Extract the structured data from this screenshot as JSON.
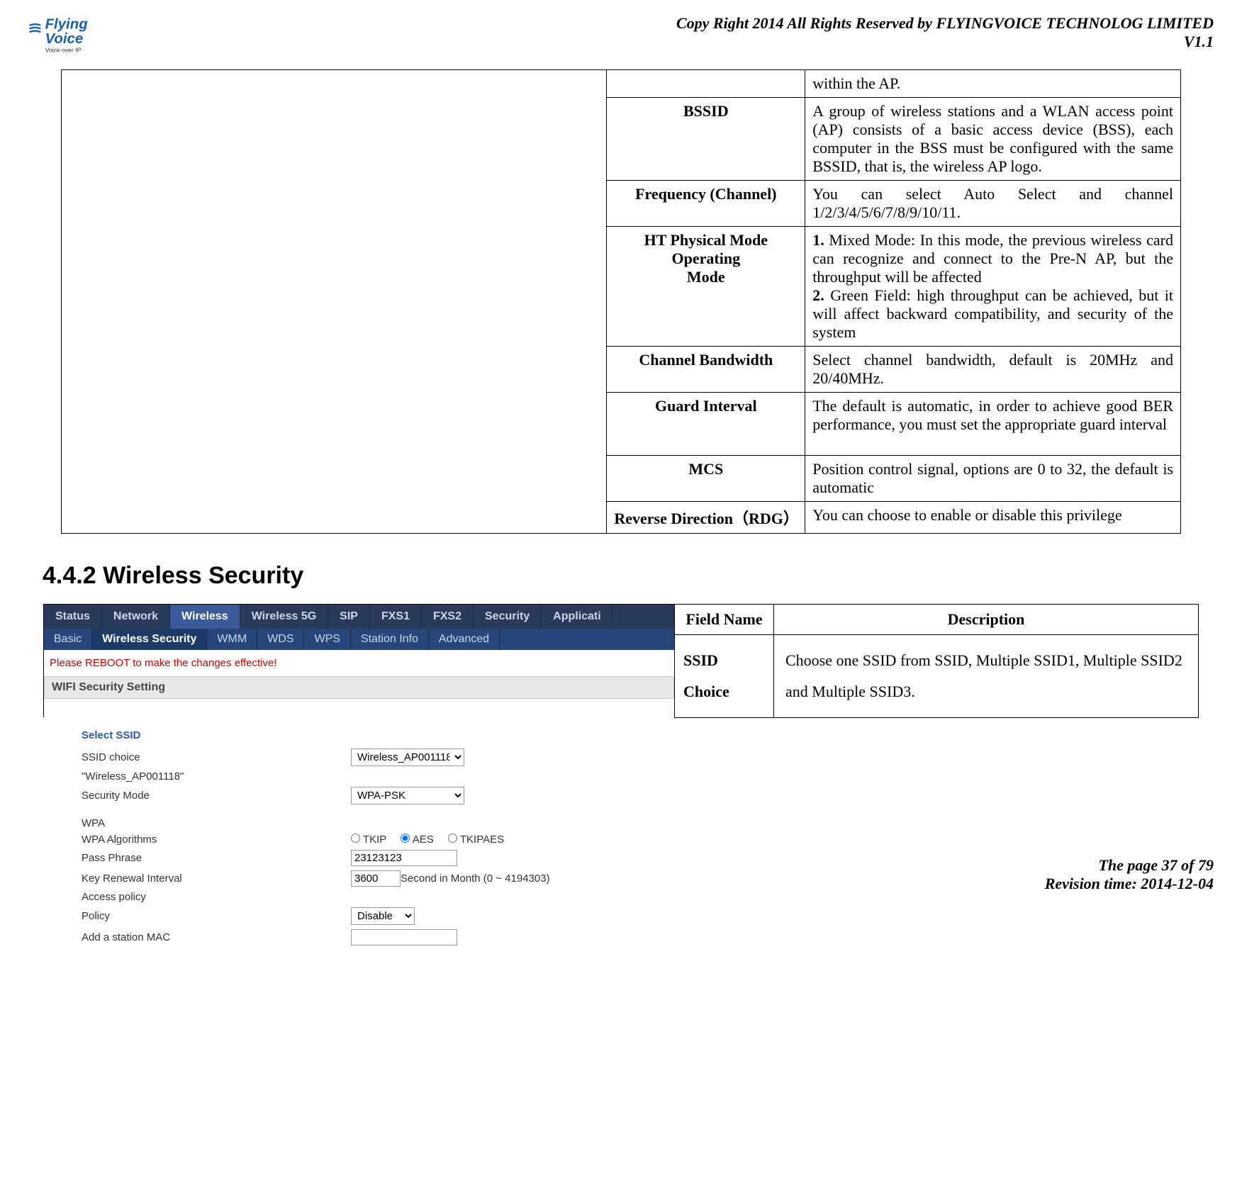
{
  "header": {
    "logo_top": "Flying",
    "logo_bottom": "Voice",
    "logo_tag": "Voice over IP",
    "copyright": "Copy Right 2014 All Rights Reserved by FLYINGVOICE TECHNOLOG LIMITED",
    "version": "V1.1"
  },
  "table1": {
    "rows": [
      {
        "field": "",
        "desc": "within the AP."
      },
      {
        "field": "BSSID",
        "desc": "A group of wireless stations and a WLAN access point (AP) consists of a basic access device (BSS), each computer in the BSS must be configured with the same BSSID, that is, the wireless AP logo."
      },
      {
        "field": "Frequency (Channel)",
        "desc": "You can select Auto Select and channel 1/2/3/4/5/6/7/8/9/10/11."
      },
      {
        "field_html": true,
        "field_lines": [
          "HT Physical Mode",
          "Operating",
          "Mode"
        ],
        "desc_parts": [
          {
            "bold": "1.",
            "text": " Mixed Mode: In this mode, the previous wireless card can recognize and connect to the Pre-N AP, but the throughput will be affected"
          },
          {
            "bold": "2.",
            "text": " Green Field: high throughput can be achieved, but it will affect backward compatibility, and security of the system"
          }
        ]
      },
      {
        "field": "Channel Bandwidth",
        "desc": "Select channel bandwidth, default is 20MHz and 20/40MHz."
      },
      {
        "field": "Guard Interval",
        "desc": "The default is automatic, in order to achieve good BER performance, you must set the appropriate guard interval"
      },
      {
        "field": "MCS",
        "desc": "Position control signal, options are 0 to 32, the default is automatic"
      },
      {
        "field": "Reverse Direction（RDG）",
        "desc": "You can choose to enable or disable this privilege"
      }
    ]
  },
  "section2": {
    "heading": "4.4.2 Wireless Security",
    "field_name_header": "Field Name",
    "description_header": "Description",
    "row": {
      "field": "SSID Choice",
      "desc": "Choose one SSID from SSID, Multiple SSID1, Multiple SSID2 and Multiple SSID3."
    }
  },
  "screenshot": {
    "tabs": [
      "Status",
      "Network",
      "Wireless",
      "Wireless 5G",
      "SIP",
      "FXS1",
      "FXS2",
      "Security",
      "Applicati"
    ],
    "active_tab": "Wireless",
    "subtabs": [
      "Basic",
      "Wireless Security",
      "WMM",
      "WDS",
      "WPS",
      "Station Info",
      "Advanced"
    ],
    "active_subtab": "Wireless Security",
    "reboot": "Please REBOOT to make the changes effective!",
    "panel": "WIFI Security Setting",
    "select_ssid_head": "Select SSID",
    "labels": {
      "ssid_choice": "SSID choice",
      "ssid_display": "\"Wireless_AP001118\"",
      "security_mode": "Security Mode",
      "wpa": "WPA",
      "wpa_algorithms": "WPA Algorithms",
      "pass_phrase": "Pass Phrase",
      "key_renewal": "Key Renewal Interval",
      "access_policy": "Access policy",
      "policy": "Policy",
      "add_mac": "Add a station MAC"
    },
    "values": {
      "ssid_choice": "Wireless_AP001118",
      "security_mode": "WPA-PSK",
      "algo_tkip": "TKIP",
      "algo_aes": "AES",
      "algo_tkipaes": "TKIPAES",
      "pass_phrase": "23123123",
      "key_renewal": "3600",
      "key_renewal_suffix": " Second in Month   (0 ~ 4194303)",
      "policy": "Disable"
    }
  },
  "footer": {
    "page": "The page 37 of 79",
    "rev": "Revision time: 2014-12-04"
  }
}
